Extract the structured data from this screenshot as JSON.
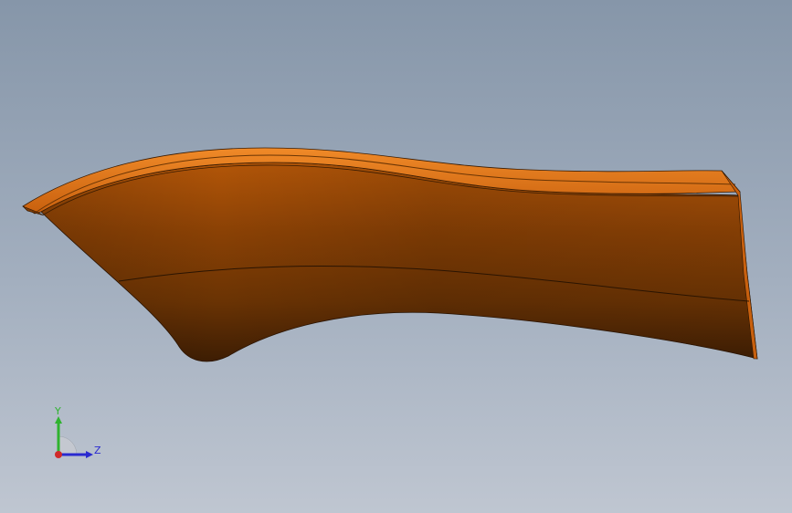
{
  "viewport": {
    "background_top": "#8696a9",
    "background_bottom": "#bfc6d1"
  },
  "model": {
    "part_color": "#d66a10",
    "highlight_color": "#f08a28",
    "shadow_color": "#5a2c05"
  },
  "triad": {
    "y_label": "Y",
    "z_label": "Z",
    "y_color": "#2fb32f",
    "z_color": "#2a2ad0",
    "x_color": "#d02a2a"
  }
}
